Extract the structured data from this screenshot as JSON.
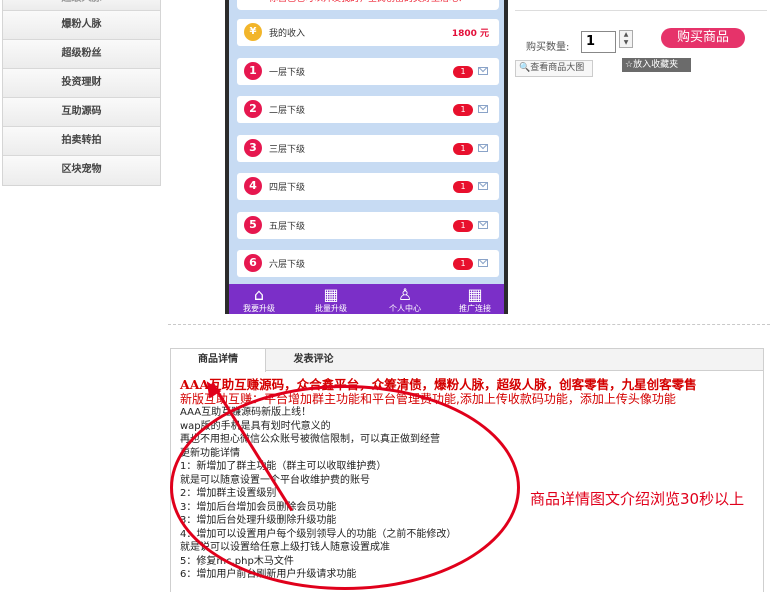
{
  "categories": [
    {
      "label": "超级人脉",
      "partial": true
    },
    {
      "label": "爆粉人脉"
    },
    {
      "label": "超级粉丝"
    },
    {
      "label": "投资理财"
    },
    {
      "label": "互助源码"
    },
    {
      "label": "拍卖转拍"
    },
    {
      "label": "区块宠物"
    }
  ],
  "phone": {
    "notice": "你自己也可以开发我的，全民创富的美好生活吧！",
    "income": {
      "label": "我的收入",
      "amount": "1800 元"
    },
    "levels": [
      {
        "num": "1",
        "label": "一层下级",
        "badge": "1"
      },
      {
        "num": "2",
        "label": "二层下级",
        "badge": "1"
      },
      {
        "num": "3",
        "label": "三层下级",
        "badge": "1"
      },
      {
        "num": "4",
        "label": "四层下级",
        "badge": "1"
      },
      {
        "num": "5",
        "label": "五层下级",
        "badge": "1"
      },
      {
        "num": "6",
        "label": "六层下级",
        "badge": "1"
      }
    ],
    "tabbar": [
      {
        "label": "我要升级",
        "icon": "home-icon"
      },
      {
        "label": "批量升级",
        "icon": "grid-icon"
      },
      {
        "label": "个人中心",
        "icon": "user-icon"
      },
      {
        "label": "推广连接",
        "icon": "grid-icon"
      }
    ]
  },
  "purchase": {
    "qty_label": "购买数量:",
    "qty_value": "1",
    "buy_label": "购买商品",
    "view_big_label": "查看商品大图",
    "fav_label": "放入收藏夹"
  },
  "details": {
    "tabs": [
      "商品详情",
      "发表评论"
    ],
    "headline": "AAA互助互赚源码，众合鑫平台，众筹清债，爆粉人脉，超级人脉，创客零售，九星创客零售",
    "subheadline": "新版互助互赚：平台增加群主功能和平台管理费功能,添加上传收款码功能，添加上传头像功能",
    "lines": [
      "AAA互助互赚源码新版上线！",
      "wap版的手机是具有划时代意义的",
      "再也不用担心微信公众账号被微信限制，可以真正做到经营",
      "更新功能详情",
      "1：新增加了群主功能（群主可以收取维护费）",
      "就是可以随意设置一个平台收维护费的账号",
      "2：增加群主设置级别",
      "3：增加后台增加会员删除会员功能",
      "3：增加后台处理升级删除升级功能",
      "4：增加可以设置用户每个级别领导人的功能（之前不能修改）",
      "就是说可以设置给任意上级打钱人随意设置成准",
      "5：修复mc.php木马文件",
      "6：增加用户前台刷新用户升级请求功能"
    ],
    "annotation": "商品详情图文介绍浏览30秒以上"
  },
  "colors": {
    "accent_red": "#e0001b",
    "buy_pink": "#e6336a",
    "tabbar_purple": "#7b2fc8",
    "phone_bg": "#c7dbf3"
  }
}
